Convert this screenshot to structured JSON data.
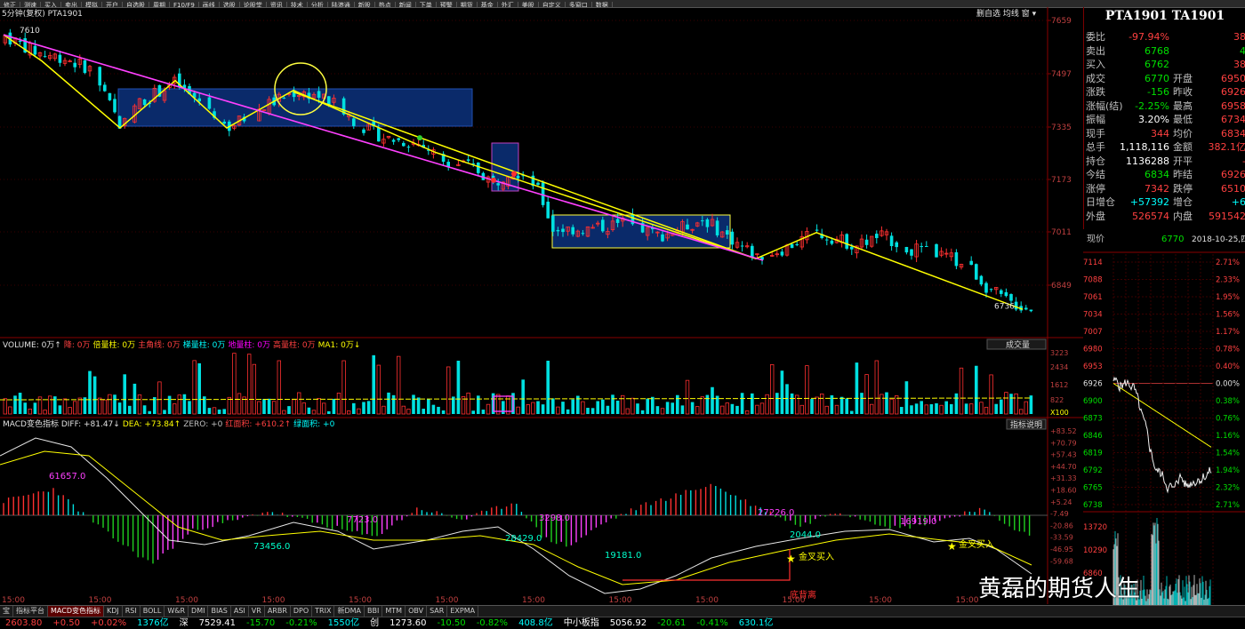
{
  "toolbar": {
    "items": [
      "修正",
      "测速",
      "买入",
      "卖出",
      "模拟",
      "开户",
      "自选股",
      "周期",
      "F10/F9",
      "画线",
      "选股",
      "论股堂",
      "资讯",
      "技术",
      "分析",
      "陆港通",
      "新股",
      "热点",
      "新闻",
      "下单",
      "预警",
      "期货",
      "基金",
      "外汇",
      "美股",
      "自定义",
      "多窗口",
      "数据"
    ]
  },
  "chart": {
    "title": "5分钟(复权)  PTA1901",
    "tools": "删自选  均线  窗  ▾",
    "price_ticks": [
      "7659",
      "7497",
      "7335",
      "7173",
      "7011",
      "6849"
    ],
    "high_label": "7610",
    "low_label": "6736",
    "volume_legend": [
      {
        "text": "VOLUME: 0万↑",
        "color": "#e0e0e0"
      },
      {
        "text": "降: 0万",
        "color": "#ff4040"
      },
      {
        "text": "倍量柱: 0万",
        "color": "#ffff00"
      },
      {
        "text": "主角线: 0万",
        "color": "#ff4040"
      },
      {
        "text": "梯量柱: 0万",
        "color": "#00ffff"
      },
      {
        "text": "地量柱: 0万",
        "color": "#ff00ff"
      },
      {
        "text": "高量柱: 0万",
        "color": "#ff4040"
      },
      {
        "text": "MA1: 0万↓",
        "color": "#ffff00"
      }
    ],
    "volume_button": "成交量",
    "volume_ticks": [
      "3223",
      "2434",
      "1612",
      "822",
      "X100"
    ],
    "macd_legend": [
      {
        "text": "MACD变色指标 DIFF: +81.47↓",
        "color": "#e0e0e0"
      },
      {
        "text": "DEA: +73.84↑",
        "color": "#ffff00"
      },
      {
        "text": "ZERO: +0",
        "color": "#c0c0c0"
      },
      {
        "text": "红面积: +610.2↑",
        "color": "#ff4040"
      },
      {
        "text": "绿面积: +0",
        "color": "#00ffff"
      }
    ],
    "macd_button": "指标说明",
    "macd_ticks": [
      "+83.52",
      "+70.79",
      "+57.43",
      "+44.70",
      "+31.33",
      "+18.60",
      "+5.24",
      "-7.49",
      "-20.86",
      "-33.59",
      "-46.95",
      "-59.68"
    ],
    "macd_annotations": [
      "61657.0",
      "73456.0",
      "7723.0",
      "28429.0",
      "3298.0",
      "19181.0",
      "27226.0",
      "2044.0",
      "16919.0",
      "金叉买入",
      "金叉买入",
      "底背离"
    ],
    "time_labels": [
      "15:00",
      "15:00",
      "15:00",
      "15:00",
      "15:00",
      "15:00",
      "15:00",
      "15:00",
      "15:00",
      "15:00",
      "15:00",
      "15:00"
    ]
  },
  "quote": {
    "title": "PTA1901 TA1901",
    "rows": [
      {
        "k": "委比",
        "v": "-97.94%",
        "vc": "red",
        "k2": "",
        "v2": "38"
      },
      {
        "k": "卖出",
        "v": "6768",
        "vc": "grn",
        "k2": "",
        "v2": "4"
      },
      {
        "k": "买入",
        "v": "6762",
        "vc": "grn",
        "k2": "",
        "v2": "38"
      },
      {
        "k": "成交",
        "v": "6770",
        "vc": "grn",
        "k2": "开盘",
        "v2": "6950"
      },
      {
        "k": "涨跌",
        "v": "-156",
        "vc": "grn",
        "k2": "昨收",
        "v2": "6926"
      },
      {
        "k": "涨幅(结)",
        "v": "-2.25%",
        "vc": "grn",
        "k2": "最高",
        "v2": "6958"
      },
      {
        "k": "振幅",
        "v": "3.20%",
        "vc": "wht",
        "k2": "最低",
        "v2": "6734"
      },
      {
        "k": "现手",
        "v": "344",
        "vc": "red",
        "k2": "均价",
        "v2": "6834"
      },
      {
        "k": "总手",
        "v": "1,118,116",
        "vc": "wht",
        "k2": "金额",
        "v2": "382.1亿"
      },
      {
        "k": "持仓",
        "v": "1136288",
        "vc": "wht",
        "k2": "开平",
        "v2": "-"
      },
      {
        "k": "今结",
        "v": "6834",
        "vc": "grn",
        "k2": "昨结",
        "v2": "6926"
      },
      {
        "k": "涨停",
        "v": "7342",
        "vc": "red",
        "k2": "跌停",
        "v2": "6510"
      },
      {
        "k": "日增仓",
        "v": "+57392",
        "vc": "cyn",
        "k2": "增仓",
        "v2": "+6"
      },
      {
        "k": "外盘",
        "v": "526574",
        "vc": "red",
        "k2": "内盘",
        "v2": "591542"
      }
    ]
  },
  "mini": {
    "now_label": "现价",
    "now_value": "6770",
    "date": "2018-10-25,四",
    "price_ticks": [
      "7114",
      "7088",
      "7061",
      "7034",
      "7007",
      "6980",
      "6953",
      "6926",
      "6900",
      "6873",
      "6846",
      "6819",
      "6792",
      "6765",
      "6738"
    ],
    "pct_ticks": [
      "2.71%",
      "2.33%",
      "1.95%",
      "1.56%",
      "1.17%",
      "0.78%",
      "0.40%",
      "0.00%",
      "0.38%",
      "0.76%",
      "1.16%",
      "1.54%",
      "1.94%",
      "2.32%",
      "2.71%"
    ],
    "vol_ticks": [
      "13720",
      "10290",
      "6860"
    ]
  },
  "indicators": {
    "items": [
      "MACD变色指标",
      "KDJ",
      "RSI",
      "BOLL",
      "W&R",
      "DMI",
      "BIAS",
      "ASI",
      "VR",
      "ARBR",
      "DPO",
      "TRIX",
      "新DMA",
      "BBI",
      "MTM",
      "OBV",
      "SAR",
      "EXPMA"
    ],
    "left": [
      "宝",
      "指标平台"
    ]
  },
  "ticker": [
    {
      "t": "2603.80",
      "c": "red"
    },
    {
      "t": "+0.50",
      "c": "red"
    },
    {
      "t": "+0.02%",
      "c": "red"
    },
    {
      "t": "1376亿",
      "c": "cyn"
    },
    {
      "t": "深",
      "c": "wht"
    },
    {
      "t": "7529.41",
      "c": "wht"
    },
    {
      "t": "-15.70",
      "c": "grn"
    },
    {
      "t": "-0.21%",
      "c": "grn"
    },
    {
      "t": "1550亿",
      "c": "cyn"
    },
    {
      "t": "创",
      "c": "wht"
    },
    {
      "t": "1273.60",
      "c": "wht"
    },
    {
      "t": "-10.50",
      "c": "grn"
    },
    {
      "t": "-0.82%",
      "c": "grn"
    },
    {
      "t": "408.8亿",
      "c": "cyn"
    },
    {
      "t": "中小板指",
      "c": "wht"
    },
    {
      "t": "5056.92",
      "c": "wht"
    },
    {
      "t": "-20.61",
      "c": "grn"
    },
    {
      "t": "-0.41%",
      "c": "grn"
    },
    {
      "t": "630.1亿",
      "c": "cyn"
    }
  ],
  "watermark": "黄磊的期货人生",
  "colors": {
    "up": "#ff3030",
    "down": "#00e0e0",
    "trend_yellow": "#ffff00",
    "trend_magenta": "#ff40ff",
    "box": "#0a2a6a",
    "bg": "#000000"
  }
}
